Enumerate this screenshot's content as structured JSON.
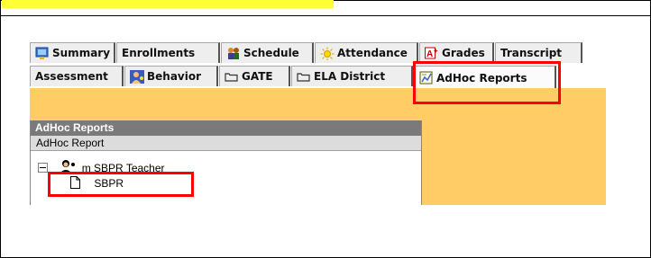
{
  "tabs_row1": [
    {
      "label": "Summary",
      "icon": "summary-icon"
    },
    {
      "label": "Enrollments",
      "icon": ""
    },
    {
      "label": "Schedule",
      "icon": "people-icon"
    },
    {
      "label": "Attendance",
      "icon": "sun-icon"
    },
    {
      "label": "Grades",
      "icon": "grades-icon"
    },
    {
      "label": "Transcript",
      "icon": ""
    }
  ],
  "tabs_row2": [
    {
      "label": "Assessment",
      "icon": ""
    },
    {
      "label": "Behavior",
      "icon": "person-icon"
    },
    {
      "label": "GATE",
      "icon": "folder-icon"
    },
    {
      "label": "ELA District",
      "icon": "folder-icon"
    },
    {
      "label": "AdHoc Reports",
      "icon": "report-icon",
      "active": true
    }
  ],
  "panel": {
    "title": "AdHoc Reports",
    "header": "AdHoc Report",
    "tree": {
      "parent_label": "m SBPR Teacher",
      "child_label": "SBPR"
    }
  },
  "colors": {
    "panel_background": "#ffcc66",
    "panel_title": "#7a7a7a",
    "highlight_box": "#ff0000",
    "top_highlight": "#ffff33"
  }
}
